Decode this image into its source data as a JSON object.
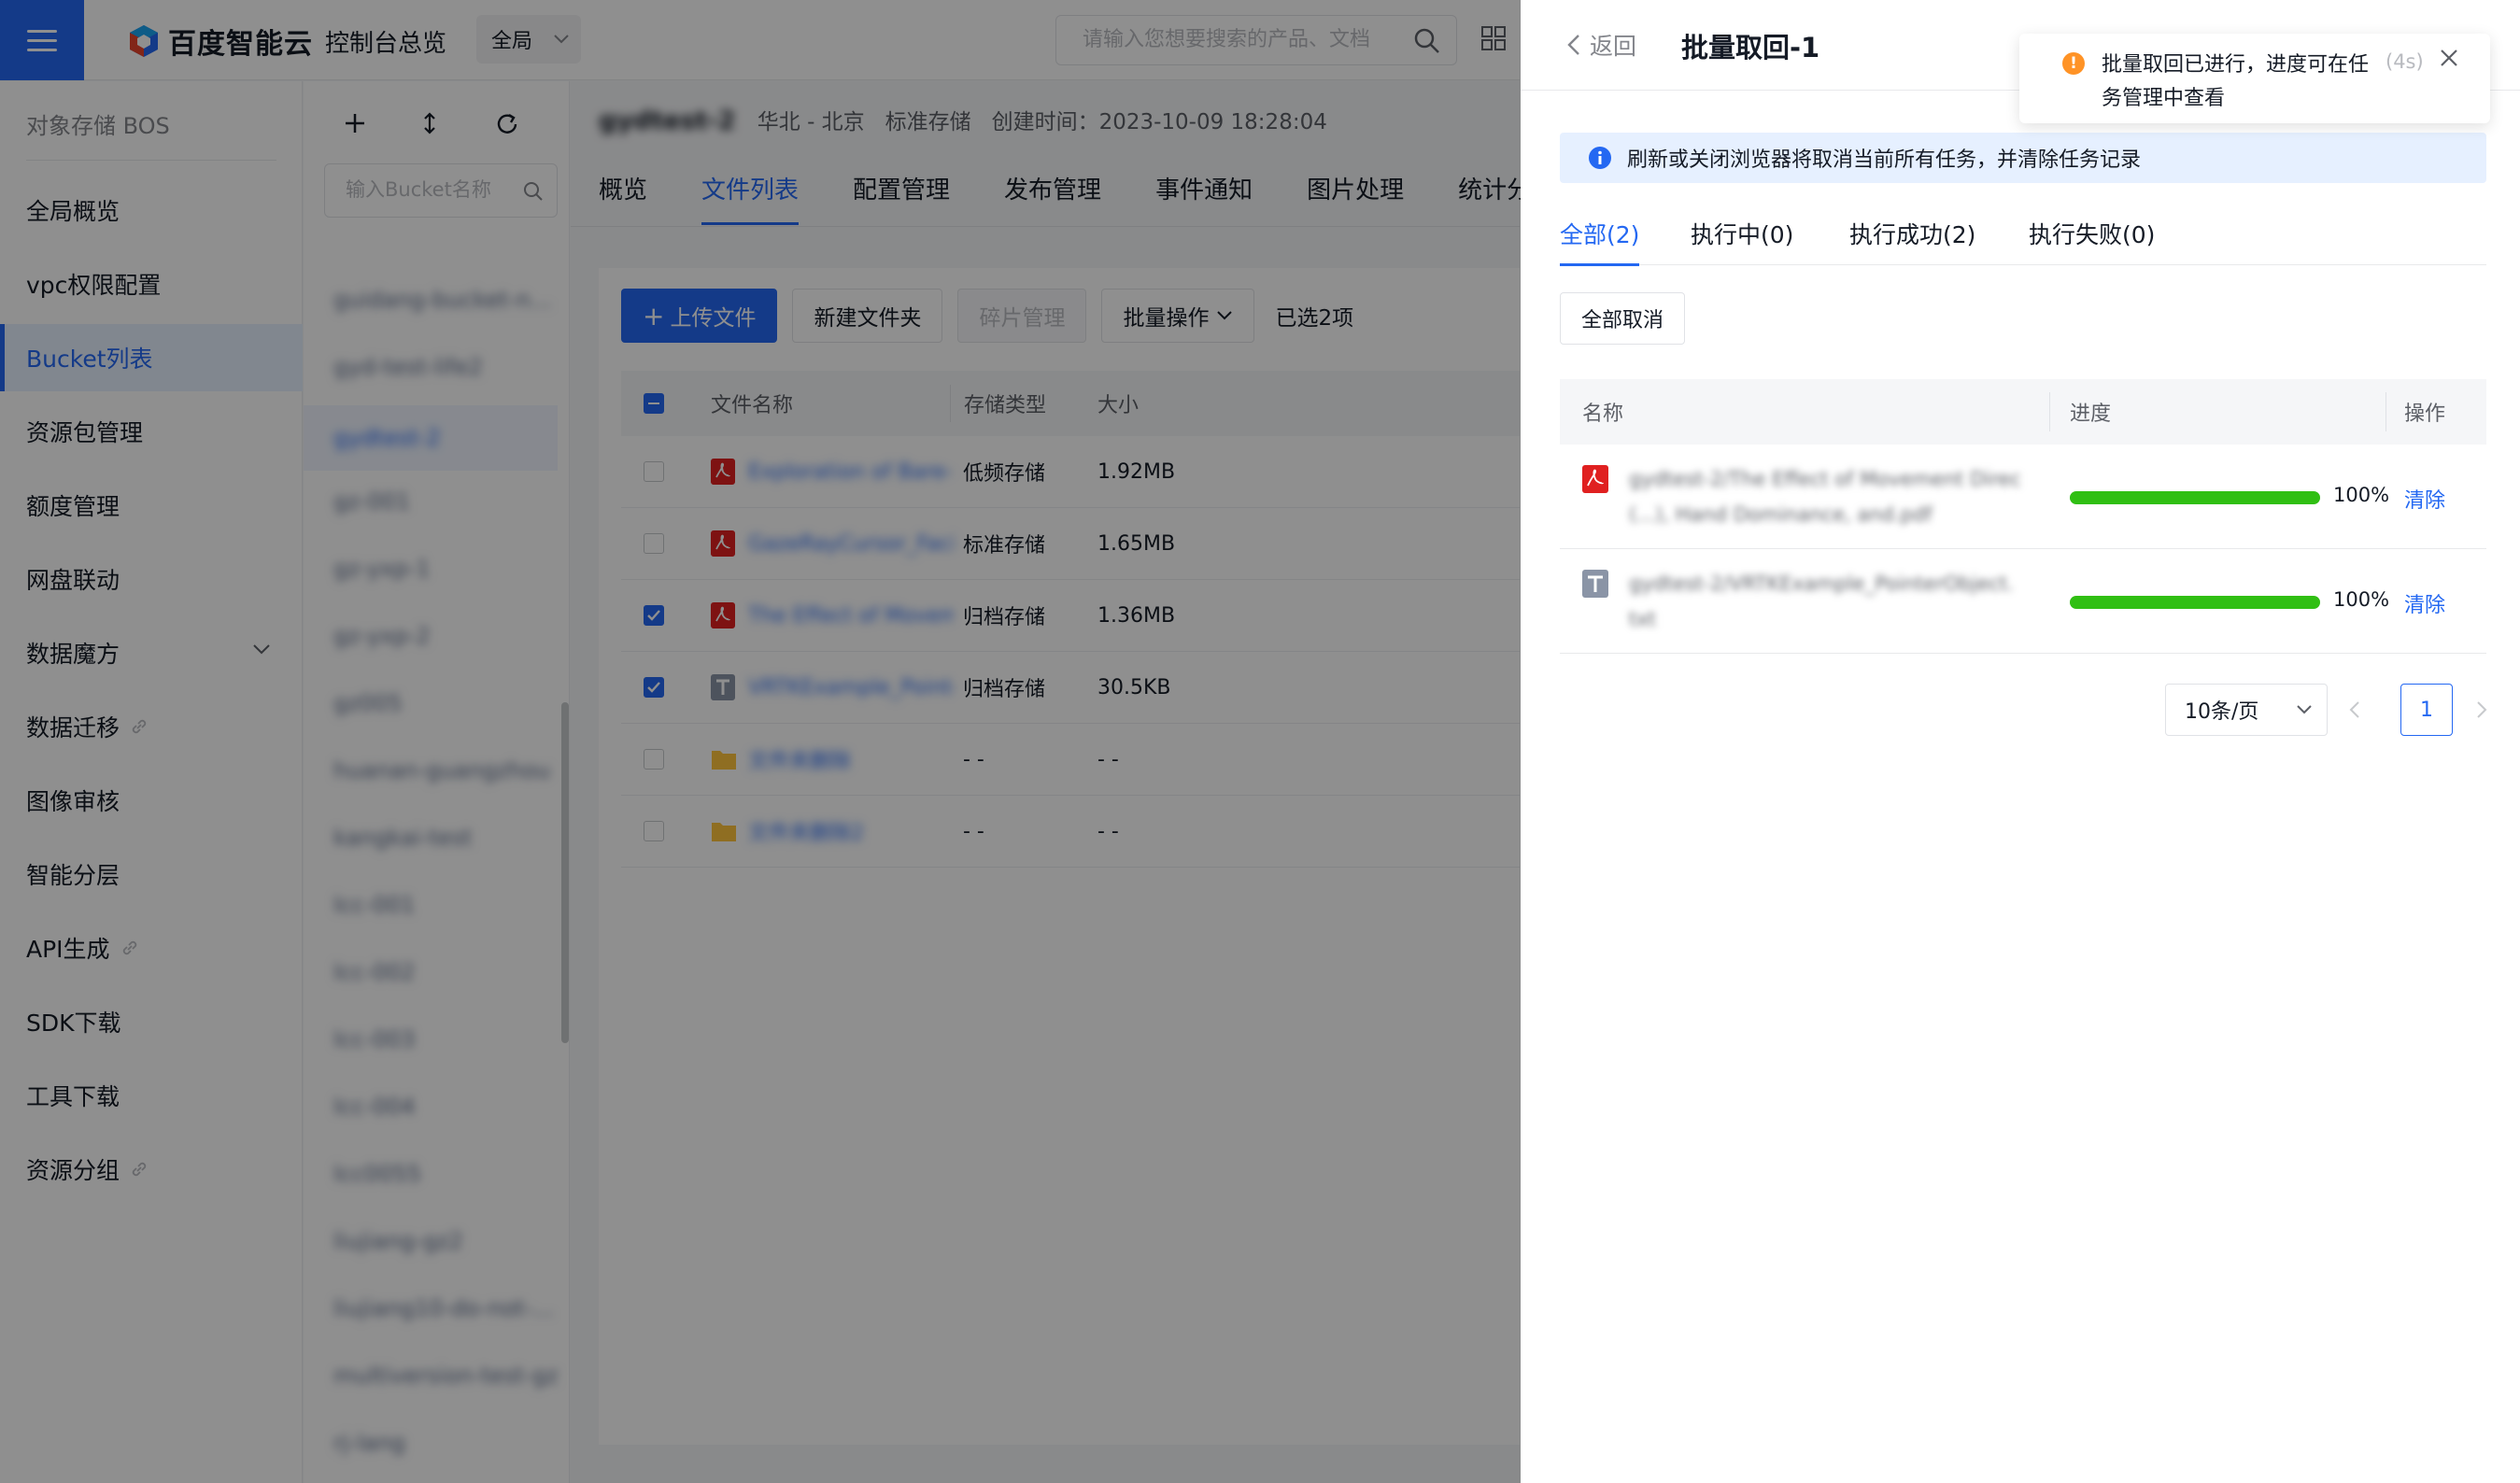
{
  "topbar": {
    "brand": "百度智能云",
    "console_home": "控制台总览",
    "region": "全局",
    "search_placeholder": "请输入您想要搜索的产品、文档"
  },
  "sidenav": {
    "title": "对象存储 BOS",
    "items": [
      {
        "label": "全局概览"
      },
      {
        "label": "vpc权限配置"
      },
      {
        "label": "Bucket列表"
      },
      {
        "label": "资源包管理"
      },
      {
        "label": "额度管理"
      },
      {
        "label": "网盘联动"
      },
      {
        "label": "数据魔方"
      },
      {
        "label": "数据迁移"
      },
      {
        "label": "图像审核"
      },
      {
        "label": "智能分层"
      },
      {
        "label": "API生成"
      },
      {
        "label": "SDK下载"
      },
      {
        "label": "工具下载"
      },
      {
        "label": "资源分组"
      }
    ]
  },
  "bucket_panel": {
    "search_placeholder": "输入Bucket名称",
    "buckets": [
      "guidang-bucket-n...",
      "gyd-test-life2",
      "gydtest-2",
      "gz-001",
      "gz-yxp-1",
      "gz-yxp-2",
      "gz005",
      "huanan-guangzhou",
      "kangkai-test",
      "lcc-001",
      "lcc-002",
      "lcc-003",
      "lcc-004",
      "lcc0055",
      "liujiang-gz2",
      "liujiang10-do-not-...",
      "multiversion-test-gz",
      "rj-lang"
    ]
  },
  "bucket_info": {
    "name": "gydtest-2",
    "region": "华北 - 北京",
    "storage_class": "标准存储",
    "created": "创建时间：2023-10-09 18:28:04"
  },
  "main_tabs": [
    "概览",
    "文件列表",
    "配置管理",
    "发布管理",
    "事件通知",
    "图片处理",
    "统计分析"
  ],
  "file_toolbar": {
    "upload": "上传文件",
    "new_folder": "新建文件夹",
    "fragment": "碎片管理",
    "batch": "批量操作",
    "selected": "已选2项"
  },
  "file_table": {
    "headers": [
      "文件名称",
      "存储类型",
      "大小"
    ],
    "rows": [
      {
        "name": "Exploration of Bare-Hand Mid-Air Poin...",
        "type": "低频存储",
        "size": "1.92MB",
        "checked": false
      },
      {
        "name": "GazeRayCursor_Facilitating Virtual Re...",
        "type": "标准存储",
        "size": "1.65MB",
        "checked": false
      },
      {
        "name": "The Effect of Movement Direction, Ha...",
        "type": "归档存储",
        "size": "1.36MB",
        "checked": true
      },
      {
        "name": "VRTKExample_PointerObject.txt",
        "type": "归档存储",
        "size": "30.5KB",
        "checked": true
      },
      {
        "name": "文件夹删除",
        "type": "- -",
        "size": "- -",
        "checked": false
      },
      {
        "name": "文件夹删除2",
        "type": "- -",
        "size": "- -",
        "checked": false
      }
    ]
  },
  "drawer": {
    "back": "返回",
    "title": "批量取回-1",
    "notice": "刷新或关闭浏览器将取消当前所有任务，并清除任务记录",
    "tabs": [
      "全部(2)",
      "执行中(0)",
      "执行成功(2)",
      "执行失败(0)"
    ],
    "cancel_all": "全部取消",
    "table_headers": [
      "名称",
      "进度",
      "操作"
    ],
    "tasks": [
      {
        "name": "gydtest-2/The Effect of Movement Direc(...), Hand Dominance, and.pdf",
        "progress": 100,
        "progress_label": "100%",
        "action": "清除"
      },
      {
        "name": "gydtest-2/VRTKExample_PointerObject.txt",
        "progress": 100,
        "progress_label": "100%",
        "action": "清除"
      }
    ],
    "page_size": "10条/页",
    "page_current": "1"
  },
  "toast": {
    "message": "批量取回已进行，进度可在任务管理中查看",
    "timer": "(4s)"
  },
  "colors": {
    "accent": "#2468f2",
    "progress": "#30bf13",
    "warning": "#ff9326",
    "pdf_icon": "#e02020"
  }
}
